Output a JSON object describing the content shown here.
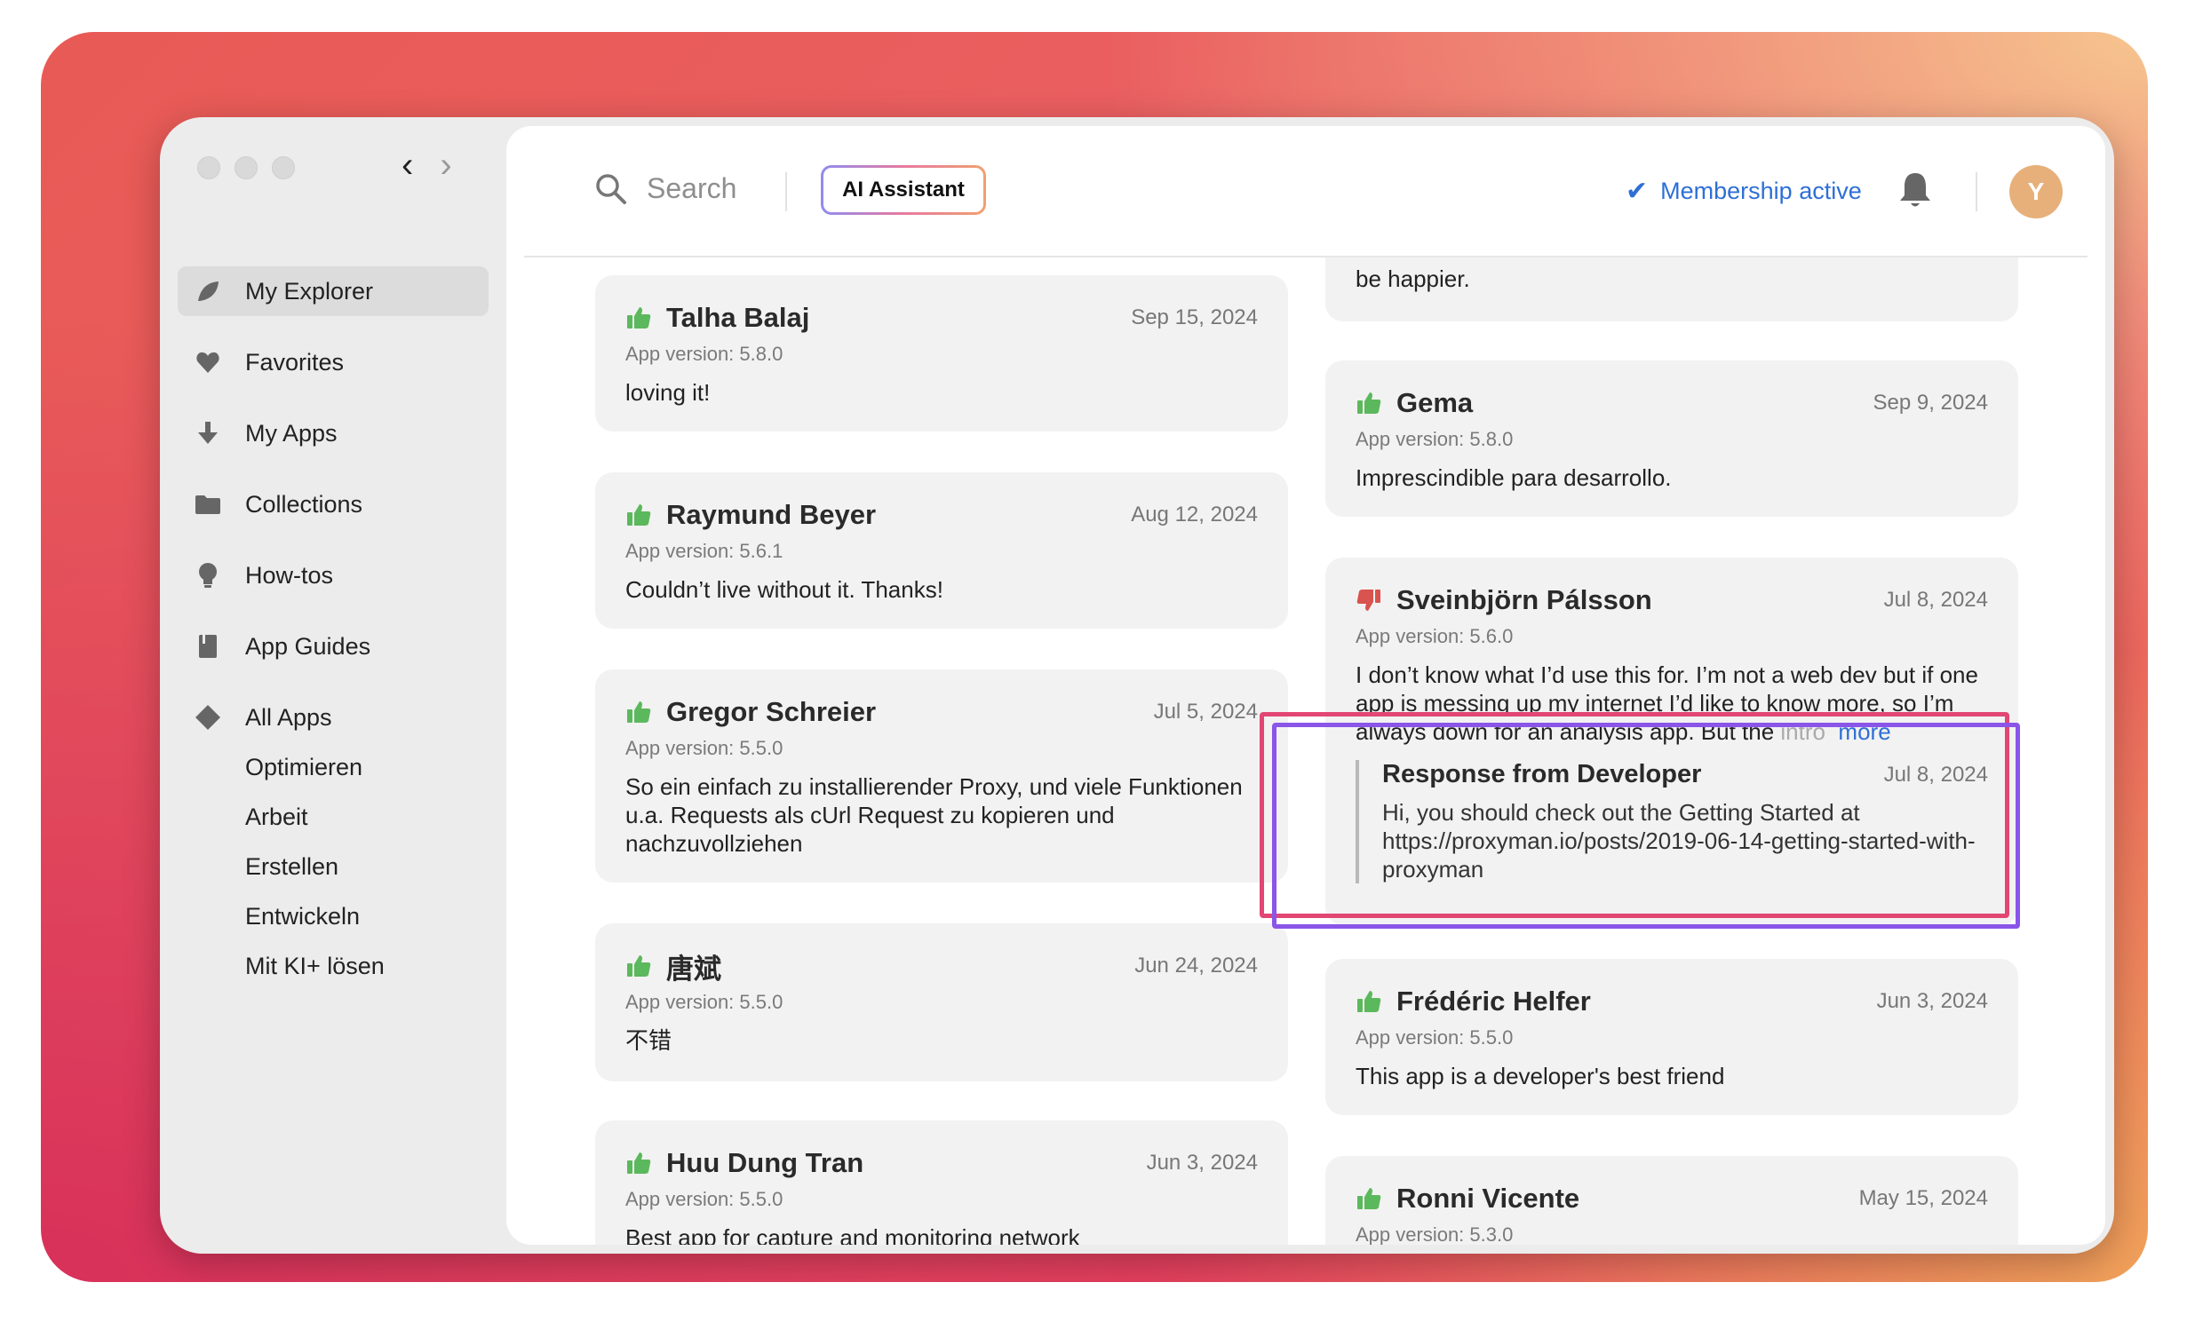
{
  "sidebar": {
    "items": [
      {
        "label": "My Explorer",
        "icon": "leaf-icon"
      },
      {
        "label": "Favorites",
        "icon": "heart-icon"
      },
      {
        "label": "My Apps",
        "icon": "download-icon"
      },
      {
        "label": "Collections",
        "icon": "folder-icon"
      },
      {
        "label": "How-tos",
        "icon": "lightbulb-icon"
      },
      {
        "label": "App Guides",
        "icon": "book-icon"
      },
      {
        "label": "All Apps",
        "icon": "diamond-icon"
      }
    ],
    "subitems": [
      "Optimieren",
      "Arbeit",
      "Erstellen",
      "Entwickeln",
      "Mit KI+ lösen"
    ]
  },
  "header": {
    "search_placeholder": "Search",
    "ai_button": "AI Assistant",
    "membership": "Membership active",
    "avatar_initial": "Y"
  },
  "reviews_left": [
    {
      "name": "Talha Balaj",
      "date": "Sep 15, 2024",
      "version": "App version: 5.8.0",
      "body": "loving it!",
      "rating": "up"
    },
    {
      "name": "Raymund Beyer",
      "date": "Aug 12, 2024",
      "version": "App version: 5.6.1",
      "body": "Couldn’t live without it. Thanks!",
      "rating": "up"
    },
    {
      "name": "Gregor Schreier",
      "date": "Jul 5, 2024",
      "version": "App version: 5.5.0",
      "body": "So ein einfach zu installierender Proxy, und viele Funktionen u.a. Requests als cUrl Request zu kopieren und nachzuvollziehen",
      "rating": "up"
    },
    {
      "name": "唐斌",
      "date": "Jun 24, 2024",
      "version": "App version: 5.5.0",
      "body": "不错",
      "rating": "up"
    },
    {
      "name": "Huu Dung Tran",
      "date": "Jun 3, 2024",
      "version": "App version: 5.5.0",
      "body": "Best app for capture and monitoring network",
      "rating": "up"
    }
  ],
  "reviews_right": {
    "partial_top_body": "be happier.",
    "gema": {
      "name": "Gema",
      "date": "Sep 9, 2024",
      "version": "App version: 5.8.0",
      "body": "Imprescindible para desarrollo."
    },
    "sveinbjorn": {
      "name": "Sveinbjörn Pálsson",
      "date": "Jul 8, 2024",
      "version": "App version: 5.6.0",
      "body": "I don’t know what I’d use this for. I’m not a web dev but if one app is messing up my internet I’d like to know more, so I’m always down for an analysis app. But the ",
      "body_fade": "intro",
      "more": "more",
      "dev_title": "Response from Developer",
      "dev_date": "Jul 8, 2024",
      "dev_body": "Hi, you should check out the Getting Started at https://proxyman.io/posts/2019-06-14-getting-started-with-proxyman"
    },
    "frederic": {
      "name": "Frédéric Helfer",
      "date": "Jun 3, 2024",
      "version": "App version: 5.5.0",
      "body": "This app is a developer's best friend"
    },
    "ronni": {
      "name": "Ronni Vicente",
      "date": "May 15, 2024",
      "version": "App version: 5.3.0"
    }
  },
  "colors": {
    "thumb_up": "#5cb85c",
    "thumb_down": "#d9534f",
    "link": "#2e6fd6"
  }
}
